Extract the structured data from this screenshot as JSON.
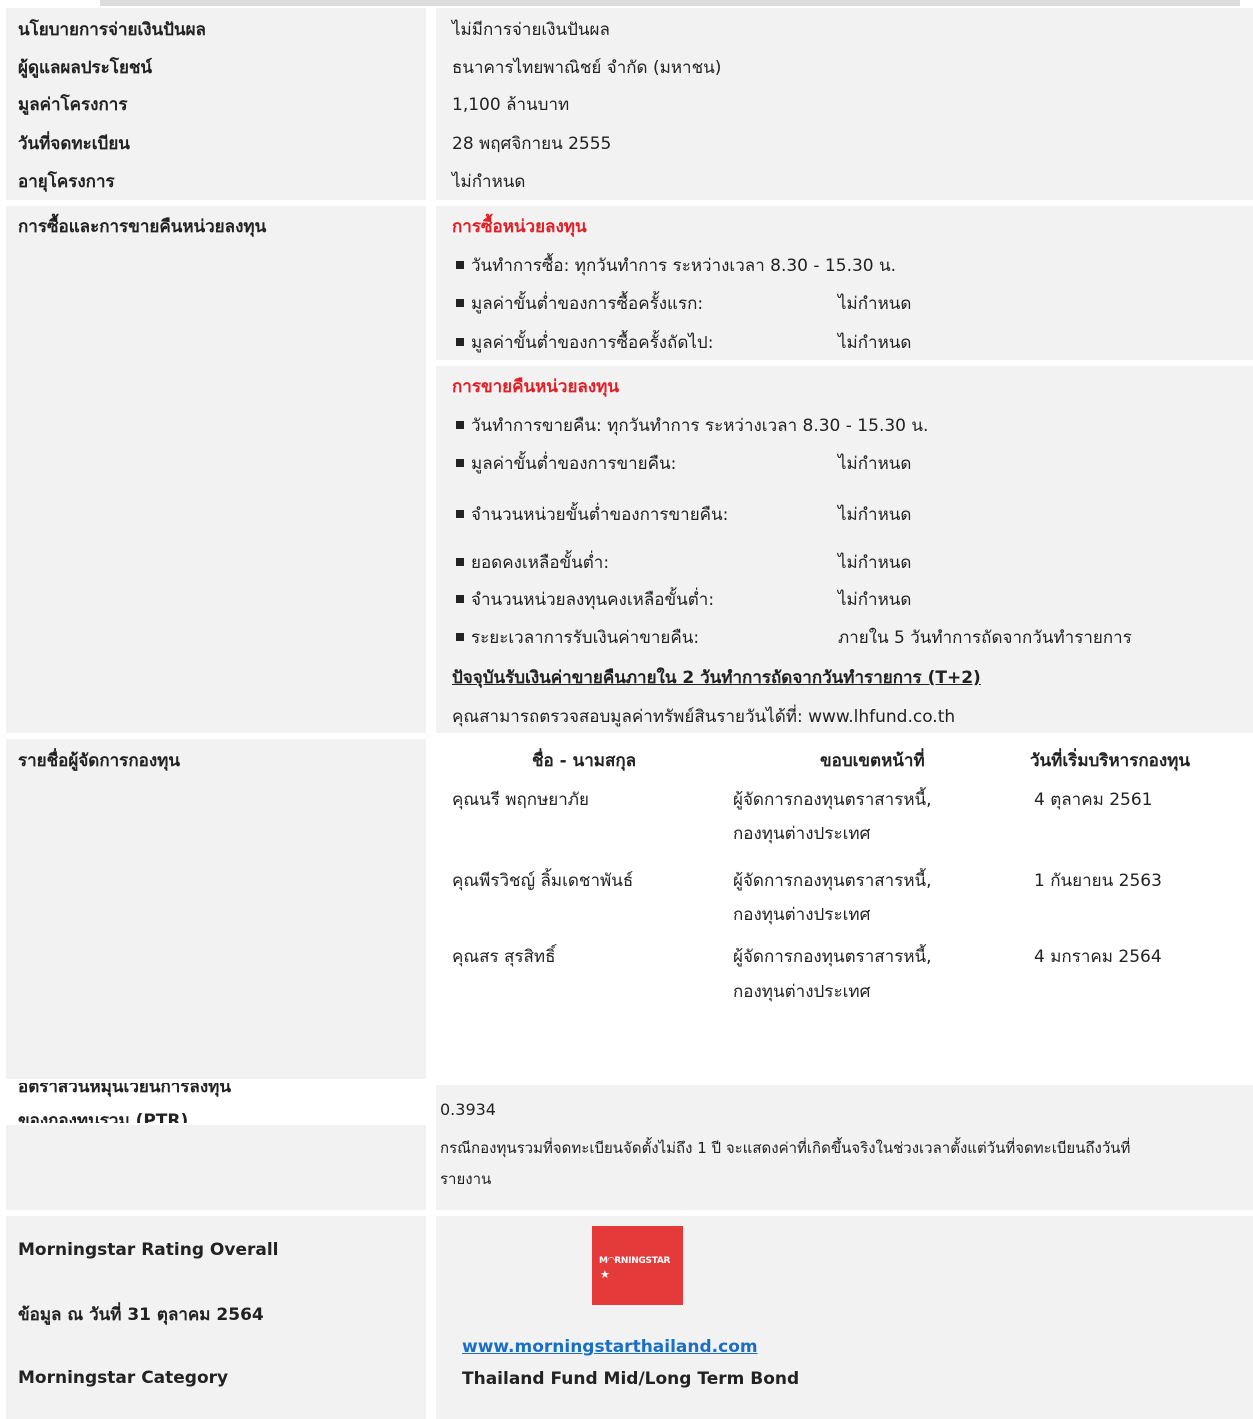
{
  "basic": {
    "dividend_label": "นโยบายการจ่ายเงินปันผล",
    "dividend_value": "ไม่มีการจ่ายเงินปันผล",
    "custodian_label": "ผู้ดูแลผลประโยชน์",
    "custodian_value": "ธนาคารไทยพาณิชย์ จำกัด (มหาชน)",
    "size_label": "มูลค่าโครงการ",
    "size_value": "1,100 ล้านบาท",
    "reg_date_label": "วันที่จดทะเบียน",
    "reg_date_value": "28 พฤศจิกายน 2555",
    "term_label": "อายุโครงการ",
    "term_value": "ไม่กำหนด"
  },
  "trading": {
    "label": "การซื้อและการขายคืนหน่วยลงทุน",
    "purchase": {
      "title": "การซื้อหน่วยลงทุน",
      "day_text": "วันทำการซื้อ: ทุกวันทำการ ระหว่างเวลา 8.30 - 15.30 น.",
      "min_first_label": "มูลค่าขั้นต่ำของการซื้อครั้งแรก:",
      "min_first_value": "ไม่กำหนด",
      "min_next_label": "มูลค่าขั้นต่ำของการซื้อครั้งถัดไป:",
      "min_next_value": "ไม่กำหนด"
    },
    "redemption": {
      "title": "การขายคืนหน่วยลงทุน",
      "day_text": "วันทำการขายคืน: ทุกวันทำการ ระหว่างเวลา 8.30 - 15.30 น.",
      "min_value_label": "มูลค่าขั้นต่ำของการขายคืน:",
      "min_value_value": "ไม่กำหนด",
      "min_units_label": "จำนวนหน่วยขั้นต่ำของการขายคืน:",
      "min_units_value": "ไม่กำหนด",
      "min_balance_label": "ยอดคงเหลือขั้นต่ำ:",
      "min_balance_value": "ไม่กำหนด",
      "min_unit_balance_label": "จำนวนหน่วยลงทุนคงเหลือขั้นต่ำ:",
      "min_unit_balance_value": "ไม่กำหนด",
      "settlement_label": "ระยะเวลาการรับเงินค่าขายคืน:",
      "settlement_value": "ภายใน 5 วันทำการถัดจากวันทำรายการ",
      "current_note": "ปัจจุบันรับเงินค่าขายคืนภายใน 2 วันทำการถัดจากวันทำรายการ (T+2)",
      "nav_note": "คุณสามารถตรวจสอบมูลค่าทรัพย์สินรายวันได้ที่: www.lhfund.co.th"
    }
  },
  "managers": {
    "label": "รายชื่อผู้จัดการกองทุน",
    "headers": [
      "ชื่อ - นามสกุล",
      "ขอบเขตหน้าที่",
      "วันที่เริ่มบริหารกองทุน"
    ],
    "rows": [
      {
        "name": "คุณนรี พฤกษยาภัย",
        "role1": "ผู้จัดการกองทุนตราสารหนี้,",
        "role2": "กองทุนต่างประเทศ",
        "date": "4 ตุลาคม 2561"
      },
      {
        "name": "คุณพีรวิชญ์ ลิ้มเดชาพันธ์",
        "role1": "ผู้จัดการกองทุนตราสารหนี้,",
        "role2": "กองทุนต่างประเทศ",
        "date": "1 กันยายน 2563"
      },
      {
        "name": "คุณสร สุรสิทธิ์",
        "role1": "ผู้จัดการกองทุนตราสารหนี้,",
        "role2": "กองทุนต่างประเทศ",
        "date": "4 มกราคม 2564"
      }
    ]
  },
  "ptr": {
    "label_line1": "อัตราส่วนหมุนเวียนการลงทุน",
    "label_line2": "ของกองทุนรวม (PTR)",
    "value": "0.3934",
    "note_line1": "กรณีกองทุนรวมที่จดทะเบียนจัดตั้งไม่ถึง 1 ปี จะแสดงค่าที่เกิดขึ้นจริงในช่วงเวลาตั้งแต่วันที่จดทะเบียนถึงวันที่",
    "note_line2": "รายงาน"
  },
  "morningstar": {
    "rating_label": "Morningstar Rating Overall",
    "as_of_label": "ข้อมูล ณ วันที่ 31 ตุลาคม 2564",
    "category_label": "Morningstar Category",
    "logo_text": "M◠RNINGSTAR",
    "logo_icon": "star-icon",
    "link_text": "www.morningstarthailand.com",
    "category_value": "Thailand Fund Mid/Long Term Bond"
  }
}
